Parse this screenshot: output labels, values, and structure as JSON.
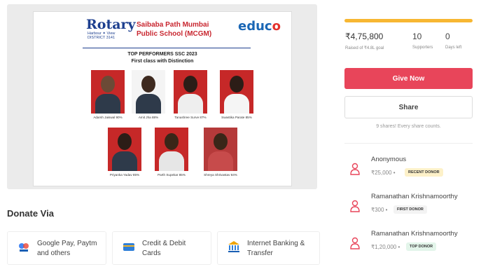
{
  "poster": {
    "rotary_word": "Rotary",
    "rotary_sub1": "Harbour ✦ View",
    "rotary_sub2": "DISTRICT 3141",
    "school_line1": "Saibaba Path Mumbai",
    "school_line2": "Public School (MCGM)",
    "educo_main": "educ",
    "educo_o": "o",
    "title_line1": "TOP PERFORMERS SSC 2023",
    "title_line2": "First class with Distinction",
    "students": [
      {
        "caption": "Adarsh Jaiswal 90%"
      },
      {
        "caption": "Amit Jha 88%"
      },
      {
        "caption": "Tanushree Surve 87%"
      },
      {
        "caption": "Swastika Parate 85%"
      },
      {
        "caption": "Priyanka Yadav 85%"
      },
      {
        "caption": "Parth Supekar 85%"
      },
      {
        "caption": "Shreya Shrivastav 84%"
      }
    ]
  },
  "donate_via": {
    "title": "Donate Via",
    "options": [
      {
        "label_line1": "Google Pay, Paytm",
        "label_line2": "and others",
        "icon": "upi-icon"
      },
      {
        "label_line1": "Credit & Debit",
        "label_line2": "Cards",
        "icon": "card-icon"
      },
      {
        "label_line1": "Internet Banking &",
        "label_line2": "Transfer",
        "icon": "bank-icon"
      }
    ]
  },
  "campaign": {
    "progress_fraction": 1.0,
    "raised": "₹4,75,800",
    "raised_label": "Raised of ₹4.8L goal",
    "supporters": "10",
    "supporters_label": "Supporters",
    "days_left": "0",
    "days_left_label": "Days left",
    "give_button": "Give Now",
    "share_button": "Share",
    "share_note": "9 shares! Every share counts."
  },
  "donors": [
    {
      "name": "Anonymous",
      "amount": "₹25,000",
      "sep": "•",
      "tag": "RECENT DONOR",
      "tag_color": "yellow"
    },
    {
      "name": "Ramanathan Krishnamoorthy",
      "amount": "₹300",
      "sep": "•",
      "tag": "FIRST DONOR",
      "tag_color": "none"
    },
    {
      "name": "Ramanathan Krishnamoorthy",
      "amount": "₹1,20,000",
      "sep": "•",
      "tag": "TOP DONOR",
      "tag_color": "green"
    }
  ],
  "colors": {
    "accent": "#e8455a",
    "progress": "#f7b732",
    "rotary_blue": "#1d3f8f",
    "school_red": "#c8262f"
  }
}
